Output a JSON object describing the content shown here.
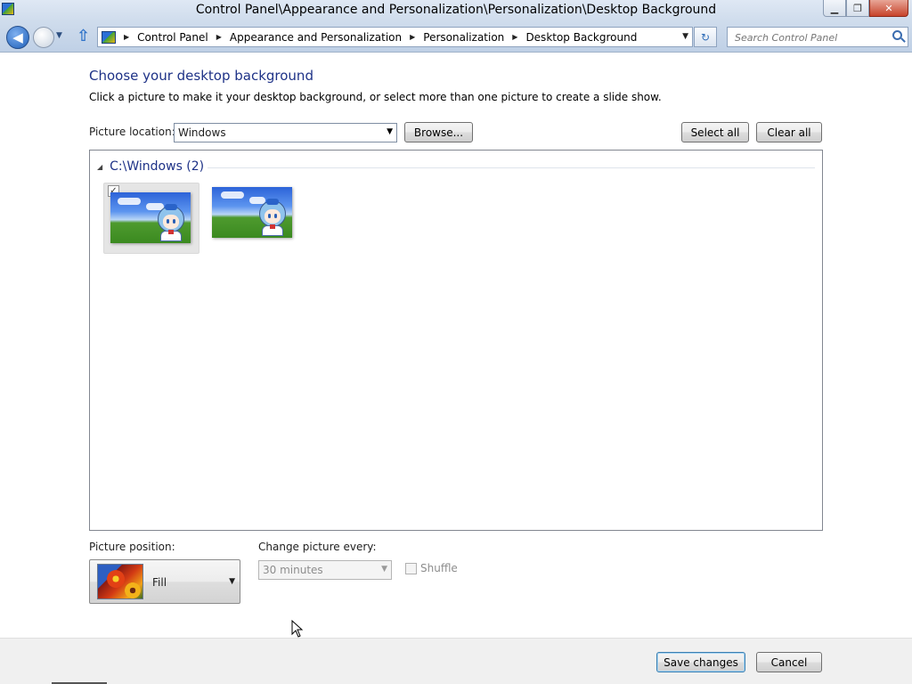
{
  "window": {
    "title": "Control Panel\\Appearance and Personalization\\Personalization\\Desktop Background",
    "minimize": "▁",
    "restore": "❐",
    "close": "✕"
  },
  "nav": {
    "back_glyph": "◀",
    "up_glyph": "⇧",
    "recent_glyph": "▼",
    "refresh_glyph": "↻",
    "breadcrumbs": [
      "Control Panel",
      "Appearance and Personalization",
      "Personalization",
      "Desktop Background"
    ],
    "search_placeholder": "Search Control Panel"
  },
  "page": {
    "heading": "Choose your desktop background",
    "subtext": "Click a picture to make it your desktop background, or select more than one picture to create a slide show."
  },
  "picture_location": {
    "label": "Picture location:",
    "value": "Windows",
    "browse_label": "Browse...",
    "select_all_label": "Select all",
    "clear_all_label": "Clear all"
  },
  "gallery": {
    "group_caret": "◢",
    "group_title": "C:\\Windows (2)",
    "items": [
      {
        "checked": true,
        "selected": true
      },
      {
        "checked": false,
        "selected": false
      }
    ]
  },
  "picture_position": {
    "label": "Picture position:",
    "value": "Fill"
  },
  "change_interval": {
    "label": "Change picture every:",
    "value": "30 minutes",
    "enabled": false
  },
  "shuffle": {
    "label": "Shuffle",
    "checked": false,
    "enabled": false
  },
  "footer": {
    "save_label": "Save changes",
    "cancel_label": "Cancel"
  },
  "colors": {
    "heading": "#1e3287",
    "titlebar": "#dfe8f4",
    "close_button": "#c7432a"
  }
}
